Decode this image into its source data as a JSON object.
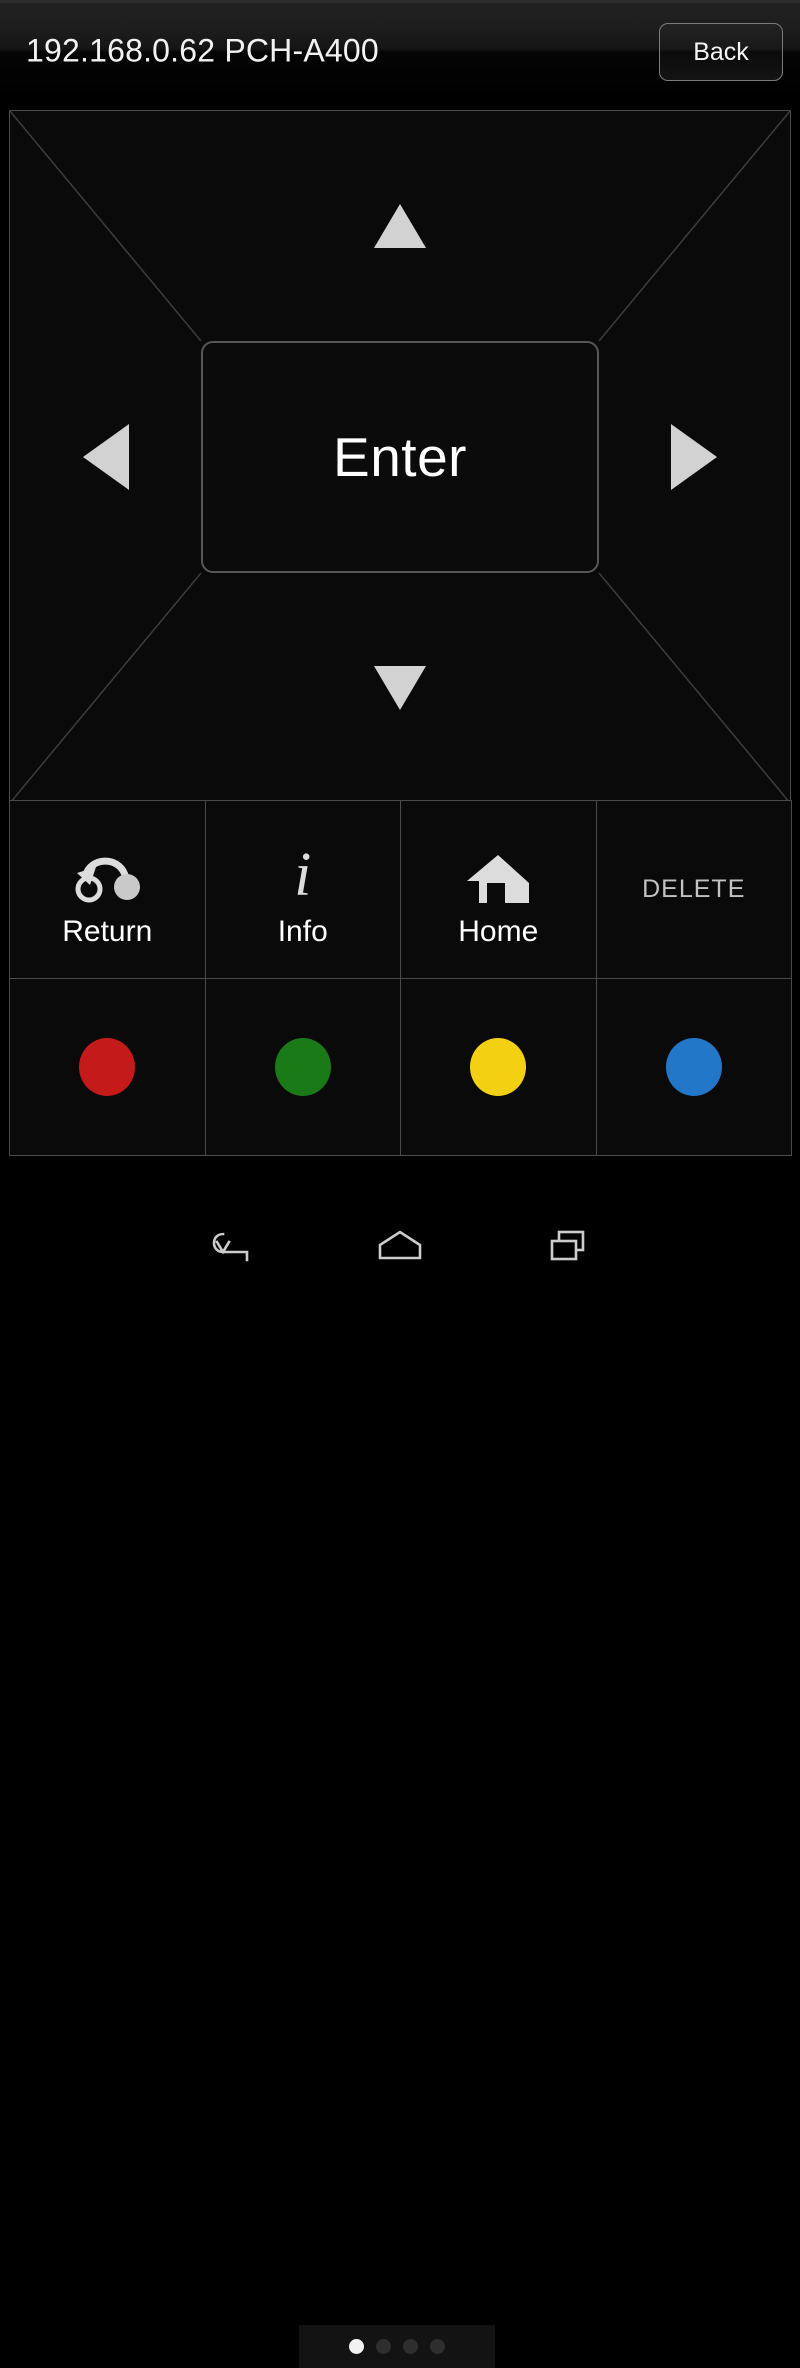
{
  "header": {
    "title": "192.168.0.62 PCH-A400",
    "back_label": "Back"
  },
  "dpad": {
    "up_icon": "triangle-up-icon",
    "down_icon": "triangle-down-icon",
    "left_icon": "triangle-left-icon",
    "right_icon": "triangle-right-icon",
    "enter_label": "Enter",
    "arrow_color": "#d2d2d2",
    "divider_color": "#3b3b3b",
    "border_color": "#4a4a4a"
  },
  "buttons": {
    "row1": [
      {
        "label": "Return",
        "icon": "return-arrow-icon",
        "type": "icon-label"
      },
      {
        "label": "Info",
        "icon": "info-italic-i-icon",
        "type": "icon-label"
      },
      {
        "label": "Home",
        "icon": "home-house-icon",
        "type": "icon-label"
      },
      {
        "label": "DELETE",
        "icon": "",
        "type": "text-only"
      }
    ],
    "row2": [
      {
        "label": "Red",
        "icon": "color-dot-red-icon",
        "type": "color",
        "color": "#c41a1a"
      },
      {
        "label": "Green",
        "icon": "color-dot-green-icon",
        "type": "color",
        "color": "#1a7a18"
      },
      {
        "label": "Yellow",
        "icon": "color-dot-yellow-icon",
        "type": "color",
        "color": "#f3d011"
      },
      {
        "label": "Blue",
        "icon": "color-dot-blue-icon",
        "type": "color",
        "color": "#2377c8"
      }
    ]
  },
  "pager": {
    "total": 4,
    "active_index": 1,
    "active_color": "#f2f2f2",
    "inactive_color": "#2e2e2e"
  },
  "navbar": {
    "items": [
      {
        "name": "android-back-icon",
        "label": "Back"
      },
      {
        "name": "android-home-icon",
        "label": "Home"
      },
      {
        "name": "android-recents-icon",
        "label": "Recents"
      }
    ]
  }
}
